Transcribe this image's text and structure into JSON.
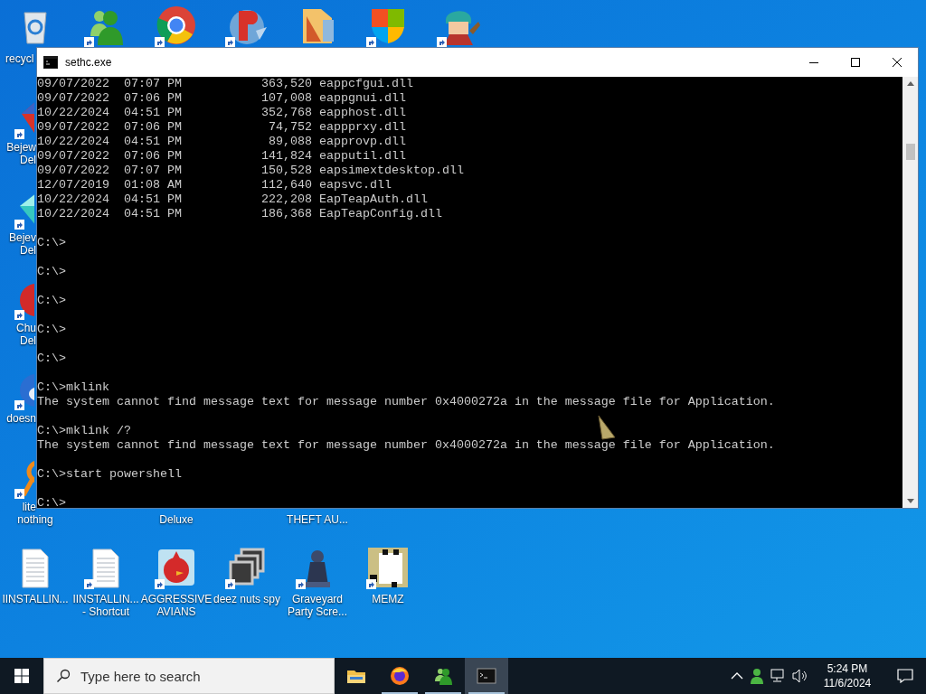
{
  "desktop": {
    "top_row": [
      {
        "label": "recycl",
        "shortcut": false
      },
      {
        "shortcut": true
      },
      {
        "shortcut": true
      },
      {
        "shortcut": true
      },
      {
        "shortcut": false
      },
      {
        "shortcut": true
      },
      {
        "shortcut": true
      }
    ],
    "left_column": [
      {
        "label": "Bejew\nDel",
        "shortcut": true
      },
      {
        "label": "Bejev\nDel",
        "shortcut": true
      },
      {
        "label": "Chu\nDel",
        "shortcut": true
      },
      {
        "label": "doesn",
        "shortcut": true
      },
      {
        "label": "lite",
        "shortcut": true
      }
    ],
    "labels_below_window": [
      "nothing",
      "Deluxe",
      "THEFT AU..."
    ],
    "bottom_row": [
      {
        "label": "IINSTALLIN...",
        "shortcut": false
      },
      {
        "label": "IINSTALLIN...\n- Shortcut",
        "shortcut": true
      },
      {
        "label": "AGGRESSIVE\nAVIANS",
        "shortcut": true
      },
      {
        "label": "deez nuts spy",
        "shortcut": true
      },
      {
        "label": "Graveyard\nParty Scre...",
        "shortcut": true
      },
      {
        "label": "MEMZ",
        "shortcut": true
      }
    ]
  },
  "window": {
    "title": "sethc.exe",
    "console_blocks": [
      [
        "09/07/2022  07:07 PM           363,520 eappcfgui.dll",
        "09/07/2022  07:06 PM           107,008 eappgnui.dll",
        "10/22/2024  04:51 PM           352,768 eapphost.dll",
        "09/07/2022  07:06 PM            74,752 eappprxy.dll",
        "10/22/2024  04:51 PM            89,088 eapprovp.dll",
        "09/07/2022  07:06 PM           141,824 eapputil.dll",
        "09/07/2022  07:07 PM           150,528 eapsimextdesktop.dll",
        "12/07/2019  01:08 AM           112,640 eapsvc.dll",
        "10/22/2024  04:51 PM           222,208 EapTeapAuth.dll",
        "10/22/2024  04:51 PM           186,368 EapTeapConfig.dll"
      ],
      [
        "C:\\>"
      ],
      [
        "C:\\>"
      ],
      [
        "C:\\>"
      ],
      [
        "C:\\>"
      ],
      [
        "C:\\>"
      ],
      [
        "C:\\>mklink",
        "The system cannot find message text for message number 0x4000272a in the message file for Application."
      ],
      [
        "C:\\>mklink /?",
        "The system cannot find message text for message number 0x4000272a in the message file for Application."
      ],
      [
        "C:\\>start powershell"
      ],
      [
        "C:\\>"
      ]
    ]
  },
  "taskbar": {
    "search": {
      "placeholder": "Type here to search"
    },
    "apps": [
      {
        "running": false,
        "selected": false
      },
      {
        "running": true,
        "selected": false
      },
      {
        "running": true,
        "selected": false
      },
      {
        "running": true,
        "selected": true
      }
    ],
    "clock": {
      "time": "5:24 PM",
      "date": "11/6/2024"
    }
  }
}
